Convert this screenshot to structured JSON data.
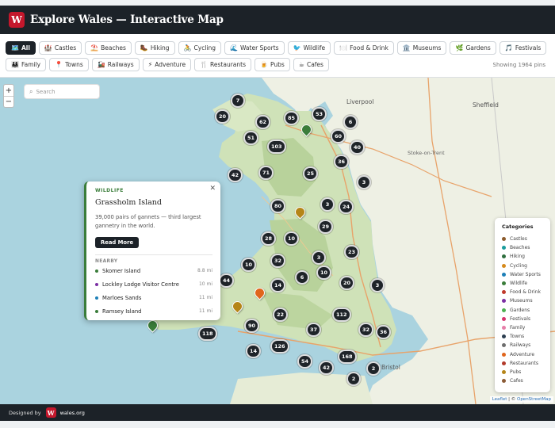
{
  "header": {
    "logo_letter": "W",
    "title": "Explore Wales — Interactive Map"
  },
  "filters": {
    "row1": [
      {
        "icon": "🗺️",
        "label": "All",
        "active": true,
        "name": "all"
      },
      {
        "icon": "🏰",
        "label": "Castles",
        "name": "castles"
      },
      {
        "icon": "⛱️",
        "label": "Beaches",
        "name": "beaches"
      },
      {
        "icon": "🥾",
        "label": "Hiking",
        "name": "hiking"
      },
      {
        "icon": "🚴",
        "label": "Cycling",
        "name": "cycling"
      },
      {
        "icon": "🌊",
        "label": "Water Sports",
        "name": "water-sports"
      },
      {
        "icon": "🐦",
        "label": "Wildlife",
        "name": "wildlife"
      },
      {
        "icon": "🍽️",
        "label": "Food & Drink",
        "name": "food-drink"
      },
      {
        "icon": "🏛️",
        "label": "Museums",
        "name": "museums"
      },
      {
        "icon": "🌿",
        "label": "Gardens",
        "name": "gardens"
      },
      {
        "icon": "🎵",
        "label": "Festivals",
        "name": "festivals"
      }
    ],
    "row2": [
      {
        "icon": "👨‍👩‍👧",
        "label": "Family",
        "name": "family"
      },
      {
        "icon": "📍",
        "label": "Towns",
        "name": "towns"
      },
      {
        "icon": "🚂",
        "label": "Railways",
        "name": "railways"
      },
      {
        "icon": "⚡",
        "label": "Adventure",
        "name": "adventure"
      },
      {
        "icon": "🍴",
        "label": "Restaurants",
        "name": "restaurants"
      },
      {
        "icon": "🍺",
        "label": "Pubs",
        "name": "pubs"
      },
      {
        "icon": "☕",
        "label": "Cafes",
        "name": "cafes"
      }
    ],
    "showing": "Showing 1964 pins"
  },
  "map": {
    "search_placeholder": "Search",
    "zoom_in": "+",
    "zoom_out": "−",
    "clusters": [
      "7",
      "20",
      "62",
      "85",
      "53",
      "6",
      "51",
      "103",
      "60",
      "40",
      "36",
      "42",
      "71",
      "25",
      "3",
      "80",
      "3",
      "24",
      "29",
      "28",
      "10",
      "10",
      "32",
      "3",
      "23",
      "6",
      "10",
      "44",
      "14",
      "20",
      "3",
      "22",
      "112",
      "90",
      "37",
      "32",
      "36",
      "118",
      "126",
      "14",
      "54",
      "168",
      "42",
      "2",
      "2"
    ],
    "places": [
      "Liverpool",
      "Sheffield",
      "Stoke-on-Trent",
      "Bristol"
    ],
    "popup": {
      "tag": "WILDLIFE",
      "name": "Grassholm Island",
      "description": "39,000 pairs of gannets — third largest gannetry in the world.",
      "button": "Read More",
      "nearby_heading": "NEARBY",
      "nearby": [
        {
          "name": "Skomer Island",
          "distance": "8.8 mi",
          "color": "#3a7d3a"
        },
        {
          "name": "Lockley Lodge Visitor Centre",
          "distance": "10 mi",
          "color": "#7b2fa3"
        },
        {
          "name": "Marloes Sands",
          "distance": "11 mi",
          "color": "#1d7fb7"
        },
        {
          "name": "Ramsey Island",
          "distance": "11 mi",
          "color": "#3a7d3a"
        }
      ]
    },
    "legend": {
      "title": "Categories",
      "items": [
        {
          "label": "Castles",
          "color": "#8b5a2b"
        },
        {
          "label": "Beaches",
          "color": "#1a9c9c"
        },
        {
          "label": "Hiking",
          "color": "#2e6e3e"
        },
        {
          "label": "Cycling",
          "color": "#d68a1c"
        },
        {
          "label": "Water Sports",
          "color": "#1d7fb7"
        },
        {
          "label": "Wildlife",
          "color": "#3a7d3a"
        },
        {
          "label": "Food & Drink",
          "color": "#c0392b"
        },
        {
          "label": "Museums",
          "color": "#7b2fa3"
        },
        {
          "label": "Gardens",
          "color": "#4caf50"
        },
        {
          "label": "Festivals",
          "color": "#d6336c"
        },
        {
          "label": "Family",
          "color": "#e67ea8"
        },
        {
          "label": "Towns",
          "color": "#2c3e50"
        },
        {
          "label": "Railways",
          "color": "#6d6d6d"
        },
        {
          "label": "Adventure",
          "color": "#e0651c"
        },
        {
          "label": "Restaurants",
          "color": "#b23a2a"
        },
        {
          "label": "Pubs",
          "color": "#b58518"
        },
        {
          "label": "Cafes",
          "color": "#8a5a35"
        }
      ]
    },
    "attribution": {
      "leaflet": "Leaflet",
      "sep": " | © ",
      "osm": "OpenStreetMap"
    }
  },
  "footer": {
    "designed_by": "Designed by",
    "logo_letter": "W",
    "site": "wales.org"
  }
}
